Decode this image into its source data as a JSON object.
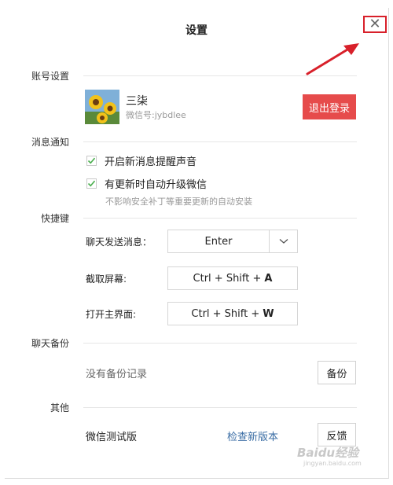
{
  "window": {
    "title": "设置",
    "close_glyph": "✕"
  },
  "account": {
    "section_label": "账号设置",
    "name": "三柒",
    "wechat_id": "微信号:jybdlee",
    "logout_label": "退出登录",
    "logout_color": "#e64b4b"
  },
  "notifications": {
    "section_label": "消息通知",
    "items": [
      {
        "label": "开启新消息提醒声音",
        "checked": true
      },
      {
        "label": "有更新时自动升级微信",
        "checked": true
      }
    ],
    "hint": "不影响安全补丁等重要更新的自动安装"
  },
  "shortcuts": {
    "section_label": "快捷键",
    "send_label": "聊天发送消息：",
    "send_value": "Enter",
    "screenshot_label": "截取屏幕:",
    "screenshot_mod": "Ctrl + Shift +",
    "screenshot_key": "A",
    "open_label": "打开主界面:",
    "open_mod": "Ctrl + Shift +",
    "open_key": "W"
  },
  "backup": {
    "section_label": "聊天备份",
    "status": "没有备份记录",
    "button_label": "备份"
  },
  "other": {
    "section_label": "其他",
    "beta_label": "微信测试版",
    "check_link": "检查新版本",
    "feedback_label": "反馈"
  },
  "watermark": {
    "text": "Baidu经验",
    "sub": "jingyan.baidu.com"
  },
  "colors": {
    "accent_red": "#e64b4b",
    "check_green": "#4caf50",
    "link_blue": "#3b6ea5",
    "annotation_red": "#d8202a"
  }
}
